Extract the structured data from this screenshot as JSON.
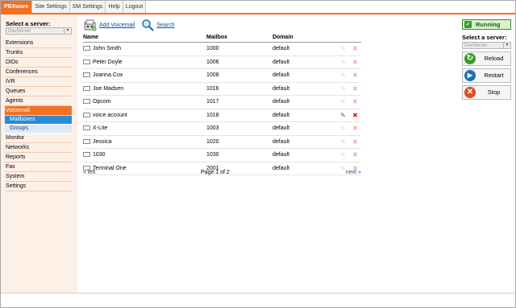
{
  "nav": {
    "logo": "PBXware",
    "tabs": [
      "Site Settings",
      "SM Settings",
      "Help",
      "Logout"
    ]
  },
  "left": {
    "server_label": "Select a server:",
    "server_value": "DevServer",
    "menu": [
      "Extensions",
      "Trunks",
      "DIDs",
      "Conferences",
      "IVR",
      "Queues",
      "Agents"
    ],
    "active_item": "Voicemail",
    "submenu": [
      "Mailboxes",
      "Groups"
    ],
    "menu_after": [
      "Monitor",
      "Networks",
      "Reports",
      "Fax",
      "System",
      "Settings"
    ]
  },
  "toolbar": {
    "add_label": "Add Voicemail",
    "search_label": "Search"
  },
  "table": {
    "columns": [
      "Name",
      "Mailbox",
      "Domain"
    ],
    "rows": [
      {
        "name": "John Smith",
        "mailbox": "1000",
        "domain": "default"
      },
      {
        "name": "Peter Doyle",
        "mailbox": "1006",
        "domain": "default"
      },
      {
        "name": "Joanna Cox",
        "mailbox": "1008",
        "domain": "default"
      },
      {
        "name": "Joe Madsen",
        "mailbox": "1016",
        "domain": "default"
      },
      {
        "name": "Opcom",
        "mailbox": "1017",
        "domain": "default"
      },
      {
        "name": "voice account",
        "mailbox": "1018",
        "domain": "default"
      },
      {
        "name": "X-Lite",
        "mailbox": "1003",
        "domain": "default"
      },
      {
        "name": "Jessica",
        "mailbox": "1020",
        "domain": "default"
      },
      {
        "name": "1030",
        "mailbox": "1030",
        "domain": "default"
      },
      {
        "name": "Terminal One",
        "mailbox": "2001",
        "domain": "default"
      }
    ],
    "highlighted_row": 5
  },
  "pager": {
    "prev": "« left",
    "info": "Page 1 of 2",
    "next": "next »"
  },
  "right": {
    "status": "Running",
    "server_label": "Select a server:",
    "server_value": "DevServer",
    "buttons": [
      "Reload",
      "Restart",
      "Stop"
    ]
  },
  "colors": {
    "accent": "#f36f21",
    "link": "#00529b",
    "running": "#3a9c26"
  }
}
